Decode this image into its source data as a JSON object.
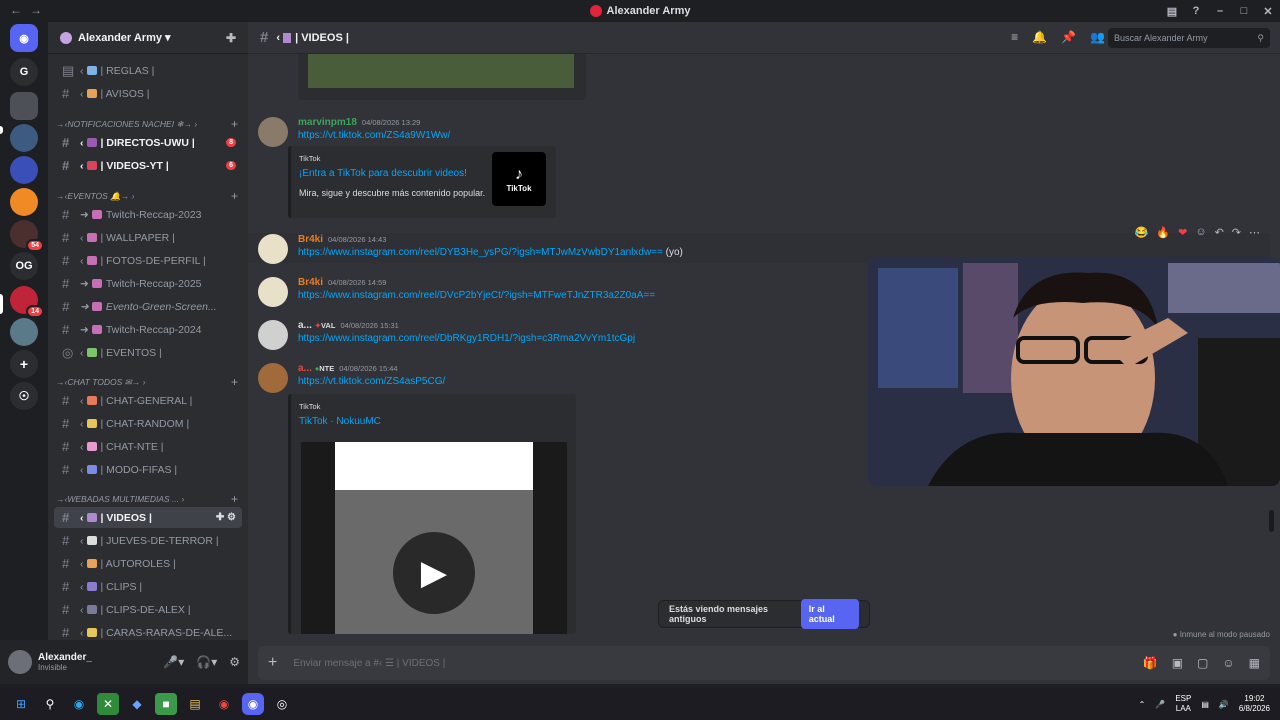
{
  "window": {
    "title": "Alexander Army"
  },
  "server": {
    "name": "Alexander Army"
  },
  "guild_rail": [
    {
      "label": "",
      "color": "#5865f2",
      "icon": "discord-icon"
    },
    {
      "label": "G",
      "color": "#2b2d31"
    },
    {
      "label": "",
      "color": "#4e5058"
    },
    {
      "label": "",
      "color": "#3d5a80"
    },
    {
      "label": "",
      "color": "#3b4fb8"
    },
    {
      "label": "",
      "color": "#f08a24"
    },
    {
      "label": "",
      "color": "#4b2f2f",
      "badge": "54"
    },
    {
      "label": "OG",
      "color": "#2b2d31"
    },
    {
      "label": "",
      "color": "#c02438",
      "badge": "14"
    },
    {
      "label": "",
      "color": "#5a7a8a"
    }
  ],
  "channels": {
    "reglas": "| REGLAS |",
    "avisos": "| AVISOS |",
    "cat_notificaciones": "NOTIFICACIONES NACHEI",
    "directos": "| DIRECTOS-UWU |",
    "directos_badge": "8",
    "videos_yt": "| VIDEOS-YT |",
    "videos_yt_badge": "6",
    "cat_eventos": "EVENTOS",
    "twitch2023": "Twitch-Reccap-2023",
    "wallpaper": "| WALLPAPER |",
    "fotos_perfil": "| FOTOS-DE-PERFIL |",
    "twitch2025": "Twitch-Reccap-2025",
    "evento_green": "Evento-Green-Screen...",
    "twitch2024": "Twitch-Reccap-2024",
    "eventos": "| EVENTOS |",
    "cat_chat": "CHAT TODOS",
    "chat_general": "| CHAT-GENERAL |",
    "chat_random": "| CHAT-RANDOM |",
    "chat_nte": "| CHAT-NTE |",
    "modo_fifas": "| MODO-FIFAS |",
    "cat_webadas": "WEBADAS MULTIMEDIAS ...",
    "videos": "| VIDEOS |",
    "jueves_terror": "| JUEVES-DE-TERROR |",
    "autoroles": "| AUTOROLES |",
    "clips": "| CLIPS |",
    "clips_alex": "| CLIPS-DE-ALEX |",
    "caras_raras": "| CARAS-RARAS-DE-ALE..."
  },
  "user": {
    "name": "Alexander_",
    "status": "Invisible"
  },
  "header": {
    "channel": "| VIDEOS |",
    "search_placeholder": "Buscar Alexander Army"
  },
  "messages": [
    {
      "author": "marvinpm18",
      "author_color": "#3ba55c",
      "time": "04/08/2026 13:29",
      "link": "https://vt.tiktok.com/ZS4a9W1Ww/"
    },
    {
      "author": "Br4ki",
      "author_color": "#e67e22",
      "time": "04/08/2026 14:43",
      "link": "https://www.instagram.com/reel/DYB3He_ysPG/?igsh=MTJwMzVwbDY1anlxdw==",
      "suffix": "(yo)"
    },
    {
      "author": "Br4ki",
      "author_color": "#e67e22",
      "time": "04/08/2026 14:59",
      "link": "https://www.instagram.com/reel/DVcP2bYjeCt/?igsh=MTFweTJnZTR3a2Z0aA=="
    },
    {
      "author": "a...",
      "author_color": "#dbdee1",
      "tag": "VAL",
      "time": "04/08/2026 15:31",
      "link": "https://www.instagram.com/reel/DbRKgy1RDH1/?igsh=c3Rma2VvYm1tcGpj"
    },
    {
      "author": "a...",
      "author_color": "#e74c3c",
      "tag": "NTE",
      "time": "04/08/2026 15:44",
      "link": "https://vt.tiktok.com/ZS4asP5CG/"
    }
  ],
  "embed1": {
    "provider": "TikTok",
    "title": "¡Entra a TikTok para descubrir videos!",
    "desc": "Mira, sigue y descubre más contenido popular.",
    "logo": "TikTok"
  },
  "embed2": {
    "provider": "TikTok",
    "title": "TikTok · NokuuMC"
  },
  "banner": {
    "text": "Estás viendo mensajes antiguos",
    "button": "Ir al actual"
  },
  "slowmode": "Inmune al modo pausado",
  "composer": {
    "placeholder": "Enviar mensaje a #‹ ☰ | VIDEOS |"
  },
  "tray": {
    "lang1": "ESP",
    "lang2": "LAA",
    "time": "19:02",
    "date": "6/8/2026"
  }
}
